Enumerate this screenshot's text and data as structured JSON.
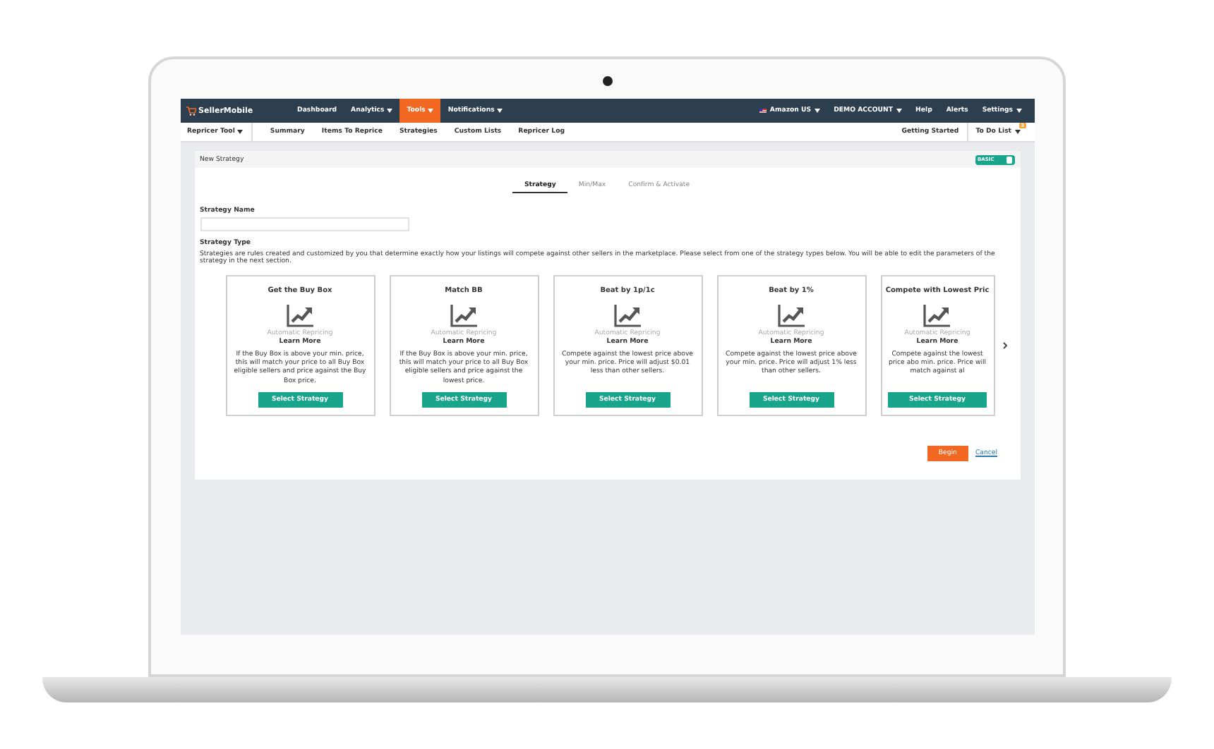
{
  "brand": "SellerMobile",
  "nav": [
    {
      "label": "Dashboard",
      "dropdown": false,
      "selected": false
    },
    {
      "label": "Analytics",
      "dropdown": true,
      "selected": false
    },
    {
      "label": "Tools",
      "dropdown": true,
      "selected": true
    },
    {
      "label": "Notifications",
      "dropdown": true,
      "selected": false
    }
  ],
  "nav_right": [
    {
      "label": "Amazon US",
      "kind": "flag"
    },
    {
      "label": "DEMO ACCOUNT",
      "kind": "dropdown"
    },
    {
      "label": "Help",
      "kind": "plain"
    },
    {
      "label": "Alerts",
      "kind": "plain"
    },
    {
      "label": "Settings",
      "kind": "dropdown"
    }
  ],
  "subnav": {
    "tool": "Repricer Tool",
    "items": [
      "Summary",
      "Items To Reprice",
      "Strategies",
      "Custom Lists",
      "Repricer Log"
    ],
    "getting_started": "Getting Started",
    "todo": {
      "label": "To Do List",
      "badge": "3"
    }
  },
  "panel": {
    "title": "New Strategy",
    "toggle": {
      "label": "BASIC",
      "on": true
    },
    "steps": [
      {
        "label": "Strategy",
        "selected": true
      },
      {
        "label": "Min/Max",
        "selected": false
      },
      {
        "label": "Confirm & Activate",
        "selected": false
      }
    ],
    "name_label": "Strategy Name",
    "type_label": "Strategy Type",
    "type_description": "Strategies are rules created and customized by you that determine exactly how your listings will compete against other sellers in the marketplace. Please select from one of the strategy types below. You will be able to edit the parameters of the strategy in the next section.",
    "cards": [
      {
        "title": "Get the Buy Box",
        "subtitle": "Automatic Repricing",
        "link": "Learn More",
        "description": "If the Buy Box is above your min. price, this will match your price to all Buy Box eligible sellers and price against the Buy Box price.",
        "button": "Select Strategy"
      },
      {
        "title": "Match BB",
        "subtitle": "Automatic Repricing",
        "link": "Learn More",
        "description": "If the Buy Box is above your min. price, this will match your price to all Buy Box eligible sellers and price against the lowest price.",
        "button": "Select Strategy"
      },
      {
        "title": "Beat by 1p/1c",
        "subtitle": "Automatic Repricing",
        "link": "Learn More",
        "description": "Compete against the lowest price above your min. price. Price will adjust $0.01 less than other sellers.",
        "button": "Select Strategy"
      },
      {
        "title": "Beat by 1%",
        "subtitle": "Automatic Repricing",
        "link": "Learn More",
        "description": "Compete against the lowest price above your min. price. Price will adjust 1% less than other sellers.",
        "button": "Select Strategy"
      },
      {
        "title": "Compete with Lowest Pric",
        "subtitle": "Automatic Repricing",
        "link": "Learn More",
        "description": "Compete against the lowest price abo min. price. Price will match against al",
        "button": "Select Strategy"
      }
    ],
    "begin": "Begin",
    "cancel": "Cancel"
  }
}
